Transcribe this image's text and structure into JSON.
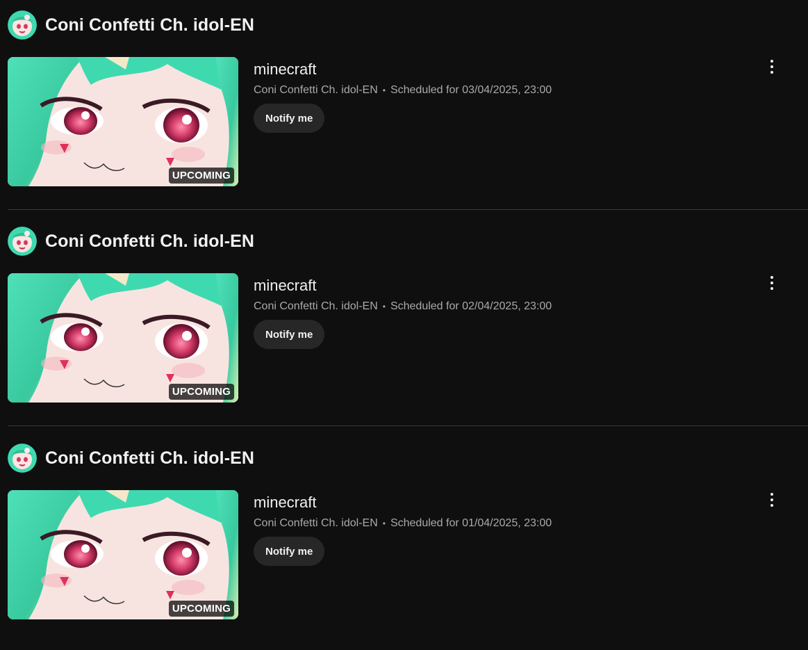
{
  "channel": {
    "name": "Coni Confetti Ch. idol-EN"
  },
  "items": [
    {
      "channel_name": "Coni Confetti Ch. idol-EN",
      "title": "minecraft",
      "meta_channel": "Coni Confetti Ch. idol-EN",
      "dot": "•",
      "schedule": "Scheduled for 03/04/2025, 23:00",
      "notify_label": "Notify me",
      "badge": "UPCOMING"
    },
    {
      "channel_name": "Coni Confetti Ch. idol-EN",
      "title": "minecraft",
      "meta_channel": "Coni Confetti Ch. idol-EN",
      "dot": "•",
      "schedule": "Scheduled for 02/04/2025, 23:00",
      "notify_label": "Notify me",
      "badge": "UPCOMING"
    },
    {
      "channel_name": "Coni Confetti Ch. idol-EN",
      "title": "minecraft",
      "meta_channel": "Coni Confetti Ch. idol-EN",
      "dot": "•",
      "schedule": "Scheduled for 01/04/2025, 23:00",
      "notify_label": "Notify me",
      "badge": "UPCOMING"
    }
  ],
  "icons": {
    "avatar": "channel-avatar",
    "menu": "more-vert-icon"
  },
  "colors": {
    "background": "#0f0f0f",
    "button": "#272727",
    "meta_text": "#aaaaaa",
    "accent_hair": "#3fd9b0",
    "eye": "#e0406a"
  }
}
